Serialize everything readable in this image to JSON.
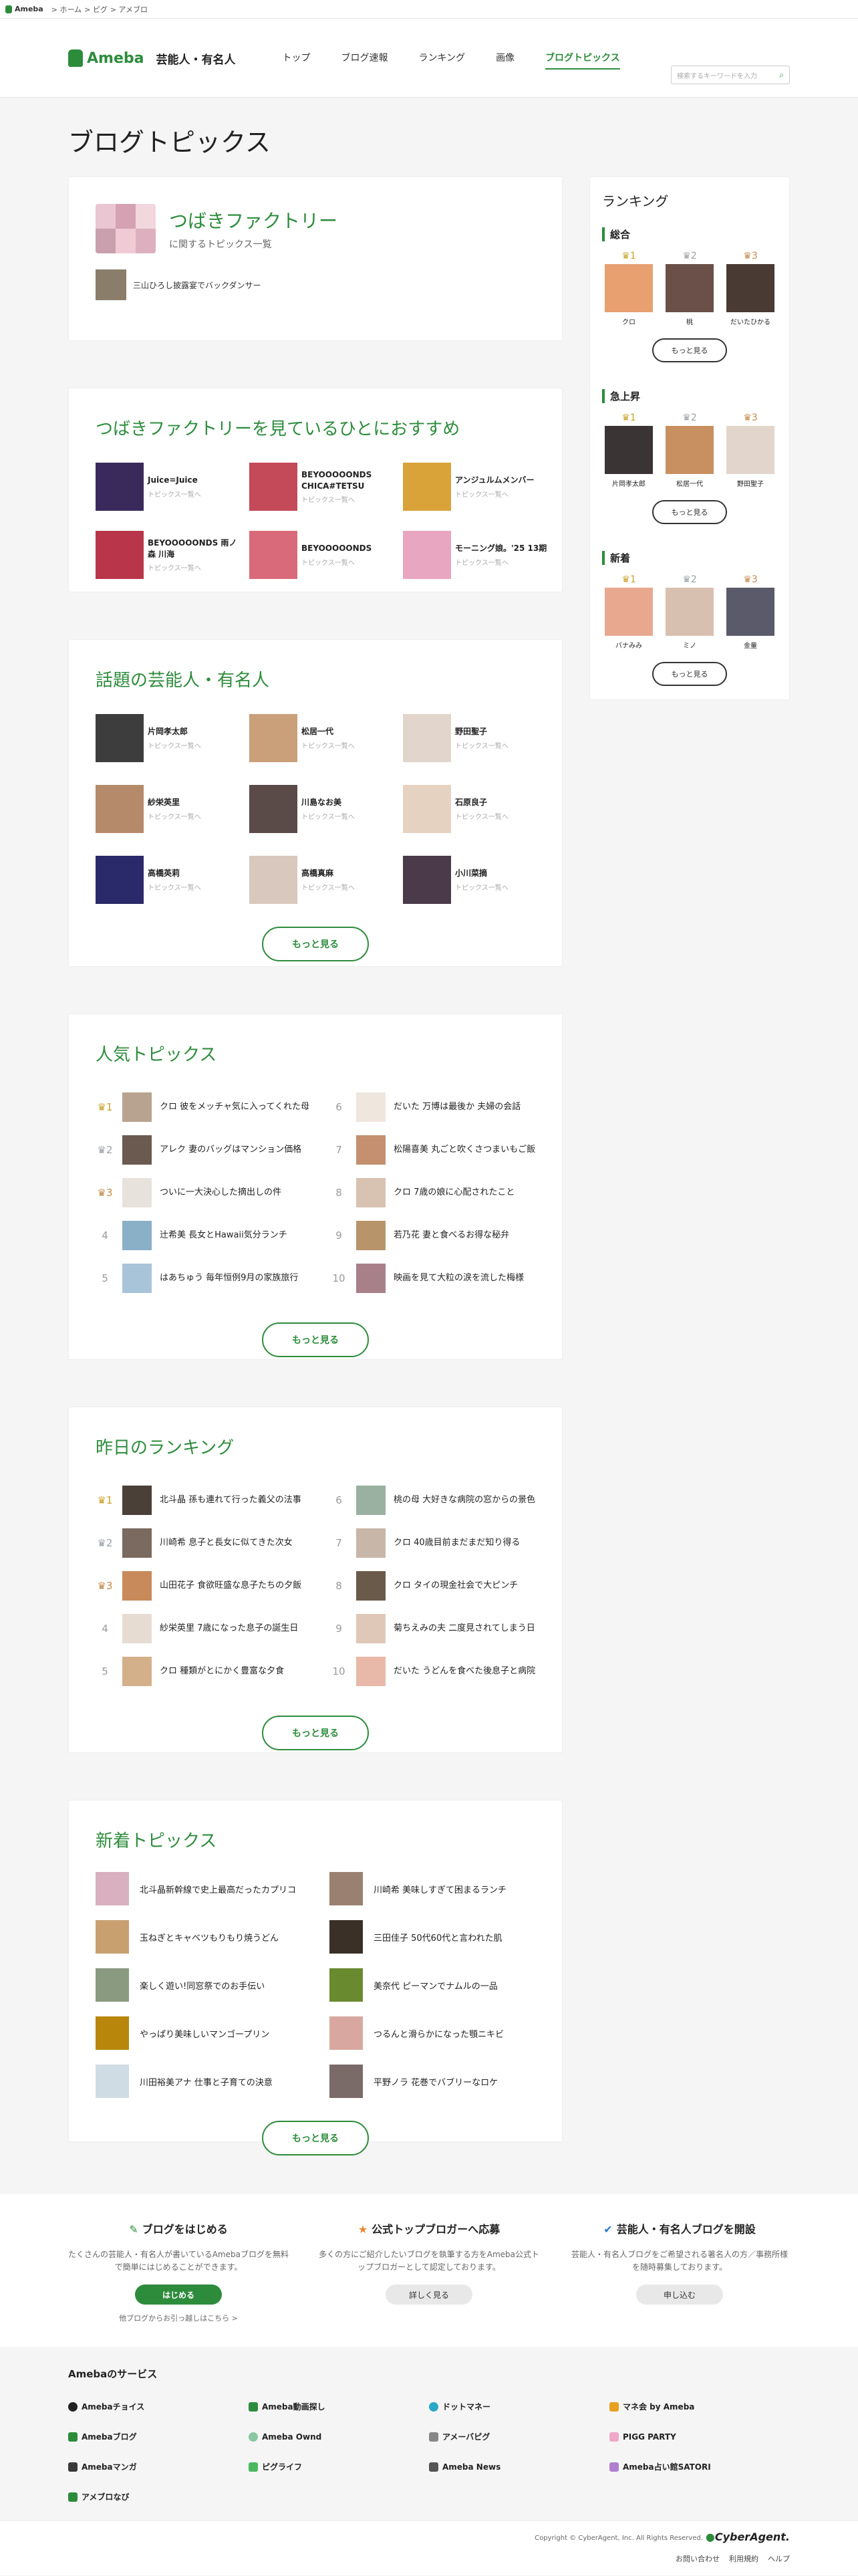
{
  "globalbar": {
    "brand": "Ameba",
    "crumbs": [
      "> ホーム",
      "> ピグ",
      "> アメブロ"
    ]
  },
  "header": {
    "logo": "Ameba",
    "category": "芸能人・有名人",
    "nav": [
      "トップ",
      "ブログ速報",
      "ランキング",
      "画像",
      "ブログトピックス"
    ],
    "search_placeholder": "検索するキーワードを入力"
  },
  "page_title": "ブログトピックス",
  "topic": {
    "title": "つばきファクトリー",
    "subtitle": "に関するトピックス一覧",
    "item": "三山ひろし披露宴でバックダンサー"
  },
  "recommend": {
    "title": "つばきファクトリーを見ているひとにおすすめ",
    "sub": "トピックス一覧へ",
    "items": [
      "Juice=Juice",
      "BEYOOOOONDS CHICA#TETSU",
      "アンジュルムメンバー",
      "BEYOOOOONDS 雨ノ森 川海",
      "BEYOOOOONDS",
      "モーニング娘。'25 13期"
    ]
  },
  "talents": {
    "title": "話題の芸能人・有名人",
    "sub": "トピックス一覧へ",
    "items": [
      "片岡孝太郎",
      "松居一代",
      "野田聖子",
      "紗栄英里",
      "川島なお美",
      "石原良子",
      "高橋英莉",
      "高橋真麻",
      "小川菜摘"
    ],
    "more": "もっと見る"
  },
  "popular": {
    "title": "人気トピックス",
    "more": "もっと見る",
    "items": [
      [
        "1",
        "クロ 彼をメッチャ気に入ってくれた母"
      ],
      [
        "2",
        "アレク 妻のバッグはマンション価格"
      ],
      [
        "3",
        "ついに一大決心した摘出しの件"
      ],
      [
        "4",
        "辻希美 長女とHawaii気分ランチ"
      ],
      [
        "5",
        "はあちゅう 毎年恒例9月の家族旅行"
      ],
      [
        "6",
        "だいた 万博は最後か 夫婦の会話"
      ],
      [
        "7",
        "松陽喜美 丸ごと吹くさつまいもご飯"
      ],
      [
        "8",
        "クロ 7歳の娘に心配されたこと"
      ],
      [
        "9",
        "若乃花 妻と食べるお得な秘弁"
      ],
      [
        "10",
        "映画を見て大粒の涙を流した梅様"
      ]
    ]
  },
  "yesterday": {
    "title": "昨日のランキング",
    "more": "もっと見る",
    "items": [
      [
        "1",
        "北斗晶 孫も連れて行った義父の法事"
      ],
      [
        "2",
        "川崎希 息子と長女に似てきた次女"
      ],
      [
        "3",
        "山田花子 食欲旺盛な息子たちの夕飯"
      ],
      [
        "4",
        "紗栄英里 7歳になった息子の誕生日"
      ],
      [
        "5",
        "クロ 種類がとにかく豊富な夕食"
      ],
      [
        "6",
        "桃の母 大好きな病院の窓からの景色"
      ],
      [
        "7",
        "クロ 40歳目前まだまだ知り得る"
      ],
      [
        "8",
        "クロ タイの現金社会で大ピンチ"
      ],
      [
        "9",
        "菊ちえみの夫 二度見されてしまう日"
      ],
      [
        "10",
        "だいた うどんを食べた後息子と病院"
      ]
    ]
  },
  "newtopics": {
    "title": "新着トピックス",
    "more": "もっと見る",
    "items": [
      "北斗晶新幹線で史上最高だったカプリコ",
      "川崎希 美味しすぎて困まるランチ",
      "玉ねぎとキャベツもりもり焼うどん",
      "三田佳子 50代60代と言われた肌",
      "楽しく遊い!同窓祭でのお手伝い",
      "美奈代 ピーマンでナムルの一品",
      "やっぱり美味しいマンゴープリン",
      "つるんと滑らかになった顎ニキビ",
      "川田裕美アナ 仕事と子育ての決意",
      "平野ノラ 花巻でバブリーなロケ"
    ]
  },
  "ranking": {
    "title": "ランキング",
    "sections": [
      {
        "label": "総合",
        "names": [
          "クロ",
          "桃",
          "だいたひかる"
        ]
      },
      {
        "label": "急上昇",
        "names": [
          "片岡孝太郎",
          "松居一代",
          "野田聖子"
        ]
      },
      {
        "label": "新着",
        "names": [
          "バナみみ",
          "ミノ",
          "金童"
        ]
      }
    ],
    "ranks": [
      "1",
      "2",
      "3"
    ],
    "more": "もっと見る"
  },
  "bottom": [
    {
      "title": "ブログをはじめる",
      "desc": "たくさんの芸能人・有名人が書いているAmebaブログを無料で簡単にはじめることができます。",
      "btn": "はじめる",
      "link": "他ブログからお引っ越しはこちら >"
    },
    {
      "title": "公式トップブロガーへ応募",
      "desc": "多くの方にご紹介したいブログを執筆する方をAmeba公式トップブロガーとして認定しております。",
      "btn": "詳しく見る",
      "link": ""
    },
    {
      "title": "芸能人・有名人ブログを開設",
      "desc": "芸能人・有名人ブログをご希望される著名人の方／事務所様を随時募集しております。",
      "btn": "申し込む",
      "link": ""
    }
  ],
  "services": {
    "title": "Amebaのサービス",
    "items": [
      "Amebaチョイス",
      "Ameba動画探し",
      "ドットマネー",
      "マネ会 by Ameba",
      "Amebaブログ",
      "Ameba Ownd",
      "アメーバピグ",
      "PIGG PARTY",
      "Amebaマンガ",
      "ピグライフ",
      "Ameba News",
      "Ameba占い館SATORI",
      "アメブロなび"
    ]
  },
  "footer": {
    "copyright": "Copyright © CyberAgent, Inc. All Rights Reserved.",
    "company": "CyberAgent.",
    "links": [
      "お問い合わせ",
      "利用規約",
      "ヘルプ"
    ]
  },
  "colors": {
    "accent": "#2d8c3c"
  }
}
